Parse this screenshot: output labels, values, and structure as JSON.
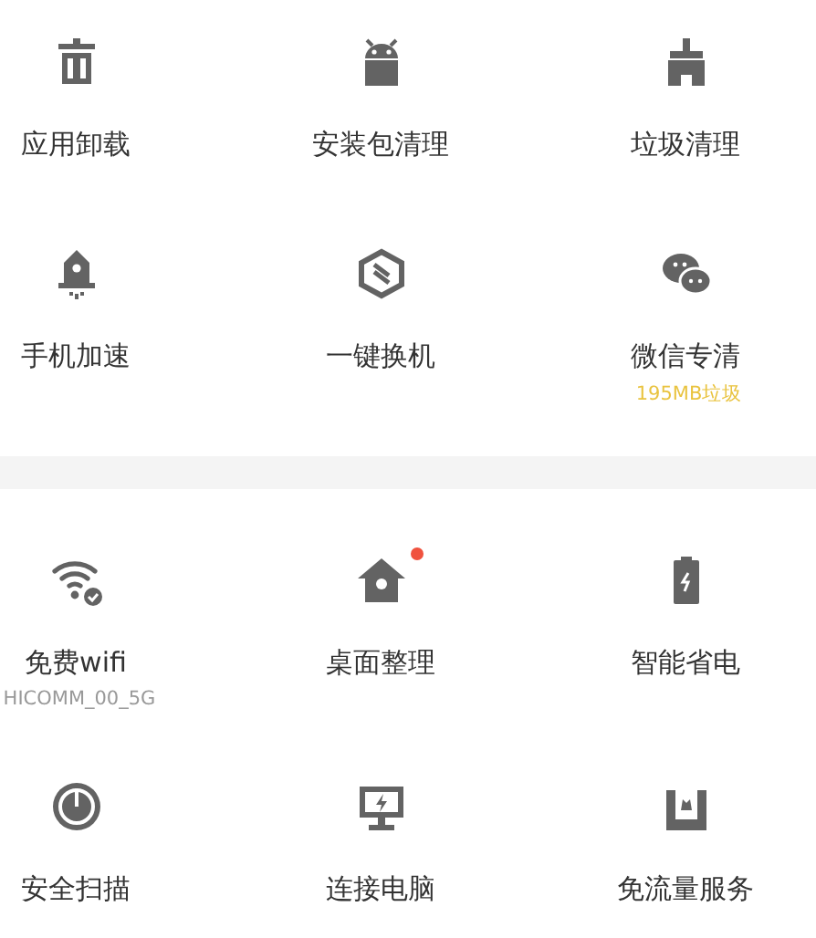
{
  "sections": [
    {
      "items": [
        {
          "label": "应用卸载",
          "badge": false
        },
        {
          "label": "安装包清理",
          "badge": false
        },
        {
          "label": "垃圾清理",
          "badge": false
        },
        {
          "label": "手机加速",
          "badge": false
        },
        {
          "label": "一键换机",
          "badge": false
        },
        {
          "label": "微信专清",
          "badge": false,
          "subtitle": {
            "text": "195MB垃圾",
            "color": "#e9c33f"
          }
        }
      ]
    },
    {
      "items": [
        {
          "label": "免费wifi",
          "badge": false,
          "subtitle": {
            "text": "HICOMM_00_5G",
            "color": "#999999"
          }
        },
        {
          "label": "桌面整理",
          "badge": true
        },
        {
          "label": "智能省电",
          "badge": false
        },
        {
          "label": "安全扫描",
          "badge": false
        },
        {
          "label": "连接电脑",
          "badge": false
        },
        {
          "label": "免流量服务",
          "badge": false
        }
      ]
    }
  ]
}
